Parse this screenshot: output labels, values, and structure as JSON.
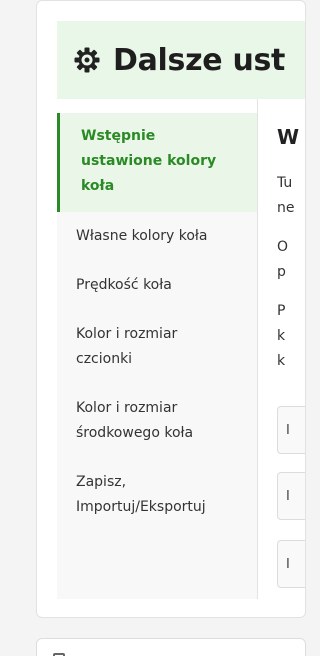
{
  "header": {
    "title": "Dalsze ust",
    "icon": "gear-icon"
  },
  "sidebar": {
    "items": [
      {
        "label": "Wstępnie\nustawione kolory\nkoła",
        "active": true
      },
      {
        "label": "Własne kolory koła",
        "active": false
      },
      {
        "label": "Prędkość koła",
        "active": false
      },
      {
        "label": "Kolor i rozmiar\nczcionki",
        "active": false
      },
      {
        "label": "Kolor i rozmiar\nśrodkowego koła",
        "active": false
      },
      {
        "label": "Zapisz,\nImportuj/Eksportuj",
        "active": false
      }
    ]
  },
  "content": {
    "heading": "W",
    "paragraphs": [
      "Tu\nne",
      "O\np",
      "P\nk\nk"
    ],
    "options": [
      "I",
      "I",
      "I"
    ]
  },
  "colors": {
    "accent": "#2a8a25",
    "header_bg": "#e9f7e8",
    "sidebar_bg": "#f8f8f8"
  }
}
